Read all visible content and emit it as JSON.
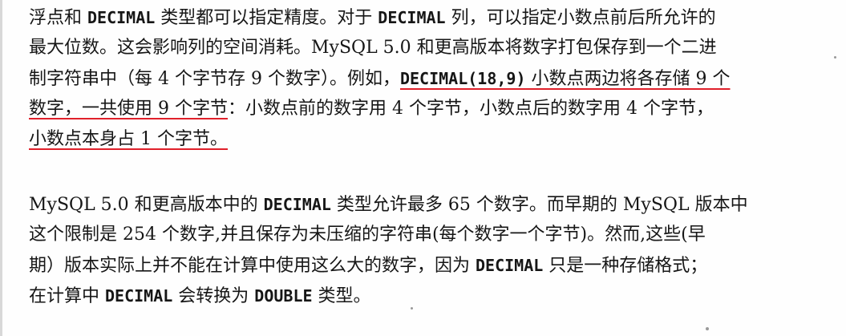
{
  "paragraph1": {
    "line1": {
      "t1": "浮点和 ",
      "m1": "DECIMAL",
      "t2": " 类型都可以指定精度。对于 ",
      "m2": "DECIMAL",
      "t3": " 列，可以指定小数点前后所允许的"
    },
    "line2": {
      "t1": "最大位数。这会影响列的空间消耗。MySQL 5.0 和更高版本将数字打包保存到一个二进"
    },
    "line3": {
      "t1": "制字符串中（每 4 个字节存 9 个数字）。例如，",
      "m1": "DECIMAL(18,9)",
      "t2": " 小数点两边将各存储 9 个"
    },
    "line4": {
      "u1": "数字，一共使用 9 个字节",
      "t1": "：小数点前的数字用 4 个字节，小数点后的数字用 4 个字节，"
    },
    "line5": {
      "u1": "小数点本身占 1 个字节。"
    }
  },
  "paragraph2": {
    "line1": {
      "t1": "MySQL 5.0 和更高版本中的 ",
      "m1": "DECIMAL",
      "t2": " 类型允许最多 65 个数字。而早期的 MySQL 版本中"
    },
    "line2": {
      "t1": "这个限制是 254 个数字,并且保存为未压缩的字符串(每个数字一个字节)。然而,这些(早"
    },
    "line3": {
      "t1": "期）版本实际上并不能在计算中使用这么大的数字，因为 ",
      "m1": "DECIMAL",
      "t2": " 只是一种存储格式；"
    },
    "line4": {
      "t1": "在计算中 ",
      "m1": "DECIMAL",
      "t2": " 会转换为 ",
      "m2": "DOUBLE",
      "t3": " 类型。"
    }
  },
  "colors": {
    "text": "#161616",
    "underline": "#e0202a",
    "background": "#fefefe"
  }
}
